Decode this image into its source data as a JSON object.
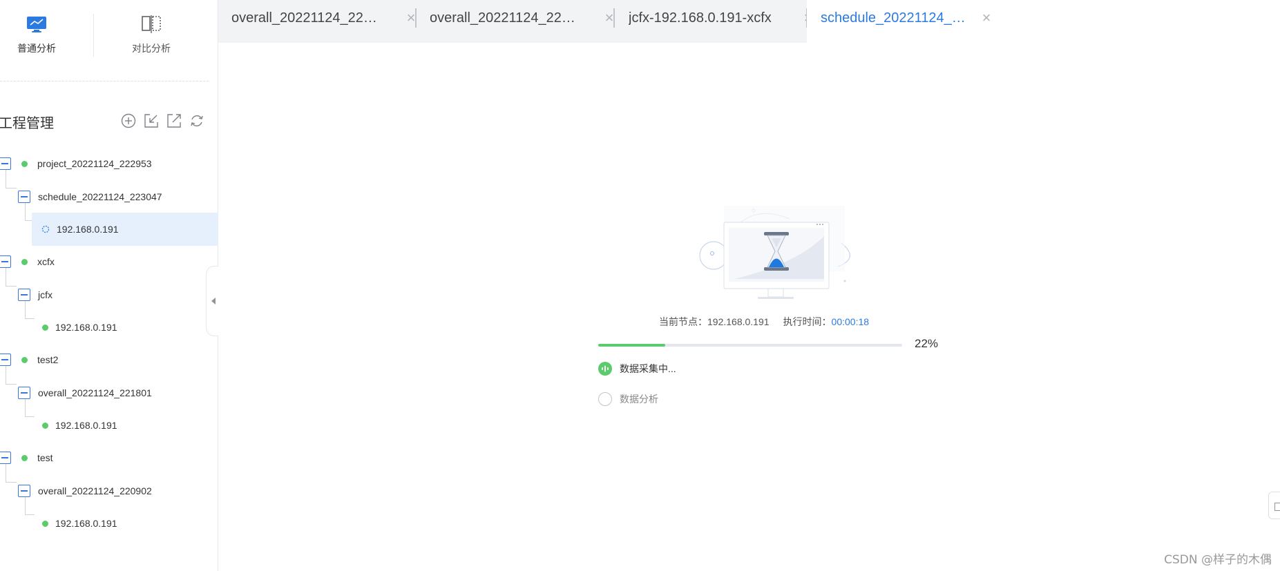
{
  "modes": {
    "ordinary_label": "普通分析",
    "compare_label": "对比分析"
  },
  "project_management": {
    "title": "工程管理",
    "actions": [
      "add-icon",
      "import-icon",
      "export-icon",
      "refresh-icon"
    ]
  },
  "tree": [
    {
      "label": "project_20221124_222953",
      "status": "green"
    },
    {
      "label": "schedule_20221124_223047"
    },
    {
      "label": "192.168.0.191",
      "status": "running",
      "selected": true
    },
    {
      "label": "xcfx",
      "status": "green"
    },
    {
      "label": "jcfx"
    },
    {
      "label": "192.168.0.191",
      "status": "green"
    },
    {
      "label": "test2",
      "status": "green"
    },
    {
      "label": "overall_20221124_221801"
    },
    {
      "label": "192.168.0.191",
      "status": "green"
    },
    {
      "label": "test",
      "status": "green"
    },
    {
      "label": "overall_20221124_220902"
    },
    {
      "label": "192.168.0.191",
      "status": "green"
    }
  ],
  "tabs": [
    {
      "label": "overall_20221124_22…",
      "close": "×"
    },
    {
      "label": "overall_20221124_22…",
      "close": "×"
    },
    {
      "label": "jcfx-192.168.0.191-xcfx",
      "close": "×"
    },
    {
      "label": "schedule_20221124_…",
      "close": "×",
      "active": true
    }
  ],
  "task": {
    "node_label": "当前节点：",
    "node_value": "192.168.0.191",
    "time_label": "执行时间：",
    "time_value": "00:00:18",
    "progress_percent": 22,
    "progress_text": "22%",
    "steps": [
      {
        "label": "数据采集中...",
        "state": "active"
      },
      {
        "label": "数据分析",
        "state": "pending"
      }
    ]
  },
  "colors": {
    "accent": "#2a7ae2",
    "success": "#5ccb6b",
    "toggle_border": "#3a74e0",
    "selected_row": "#e6f0fd"
  },
  "watermark": "CSDN @样子的木偶"
}
